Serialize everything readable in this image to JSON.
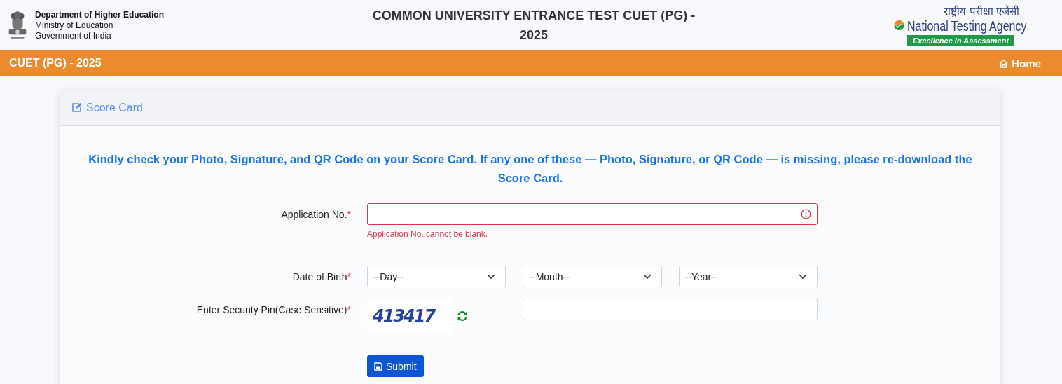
{
  "header": {
    "dept_lines": [
      "Department of Higher Education",
      "Ministry of Education",
      "Government of India"
    ],
    "title": "COMMON UNIVERSITY ENTRANCE TEST CUET (PG) - 2025",
    "agency_hindi": "राष्ट्रीय परीक्षा एजेंसी",
    "agency_name": "National Testing Agency",
    "agency_tagline": "Excellence in Assessment"
  },
  "nav_bar": {
    "brand": "CUET (PG) - 2025",
    "home_link": "Home"
  },
  "card": {
    "title": "Score Card",
    "notice": "Kindly check your Photo, Signature, and QR Code on your Score Card. If any one of these — Photo, Signature, or QR Code — is missing, please re-download the Score Card."
  },
  "form": {
    "application_no": {
      "label": "Application No.",
      "required_mark": "*",
      "invalid": true,
      "error": "Application No. cannot be blank."
    },
    "date_of_birth": {
      "label": "Date of Birth",
      "required_mark": "*",
      "selects": [
        "--Day--",
        "--Month--",
        "--Year--"
      ]
    },
    "security_pin": {
      "label": "Enter Security Pin(Case Sensitive)",
      "required_mark": "*",
      "captcha": "413417"
    },
    "submit": "Submit"
  }
}
